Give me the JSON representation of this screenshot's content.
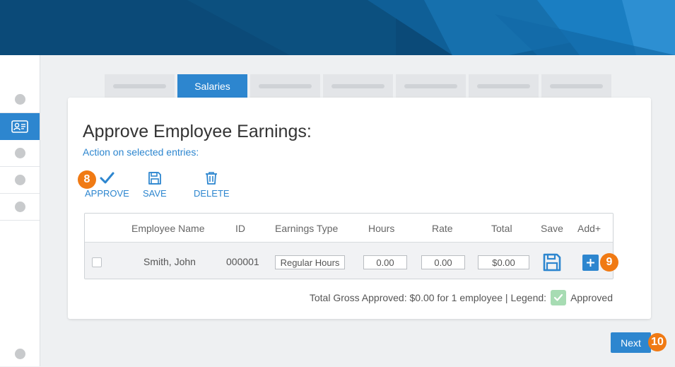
{
  "tabs": [
    {
      "label": ""
    },
    {
      "label": "Salaries",
      "active": true
    },
    {
      "label": ""
    },
    {
      "label": ""
    },
    {
      "label": ""
    },
    {
      "label": ""
    },
    {
      "label": ""
    }
  ],
  "page": {
    "title": "Approve Employee Earnings:",
    "subtitle": "Action on selected entries:"
  },
  "actions": {
    "approve_label": "APPROVE",
    "save_label": "SAVE",
    "delete_label": "DELETE"
  },
  "table": {
    "columns": [
      "Employee Name",
      "ID",
      "Earnings Type",
      "Hours",
      "Rate",
      "Total",
      "Save",
      "Add+"
    ],
    "rows": [
      {
        "employee_name": "Smith, John",
        "id": "000001",
        "earnings_type": "Regular Hours",
        "hours": "0.00",
        "rate": "0.00",
        "total": "$0.00"
      }
    ]
  },
  "footer": {
    "summary": "Total Gross Approved: $0.00 for 1 employee | Legend:",
    "legend_label": "Approved"
  },
  "badges": {
    "approve": "8",
    "add": "9",
    "next": "10"
  },
  "next_label": "Next",
  "colors": {
    "accent": "#2d86cf",
    "banner": "#0b4a78",
    "badge": "#f07a14",
    "legend_approved": "#a7dcb3"
  }
}
